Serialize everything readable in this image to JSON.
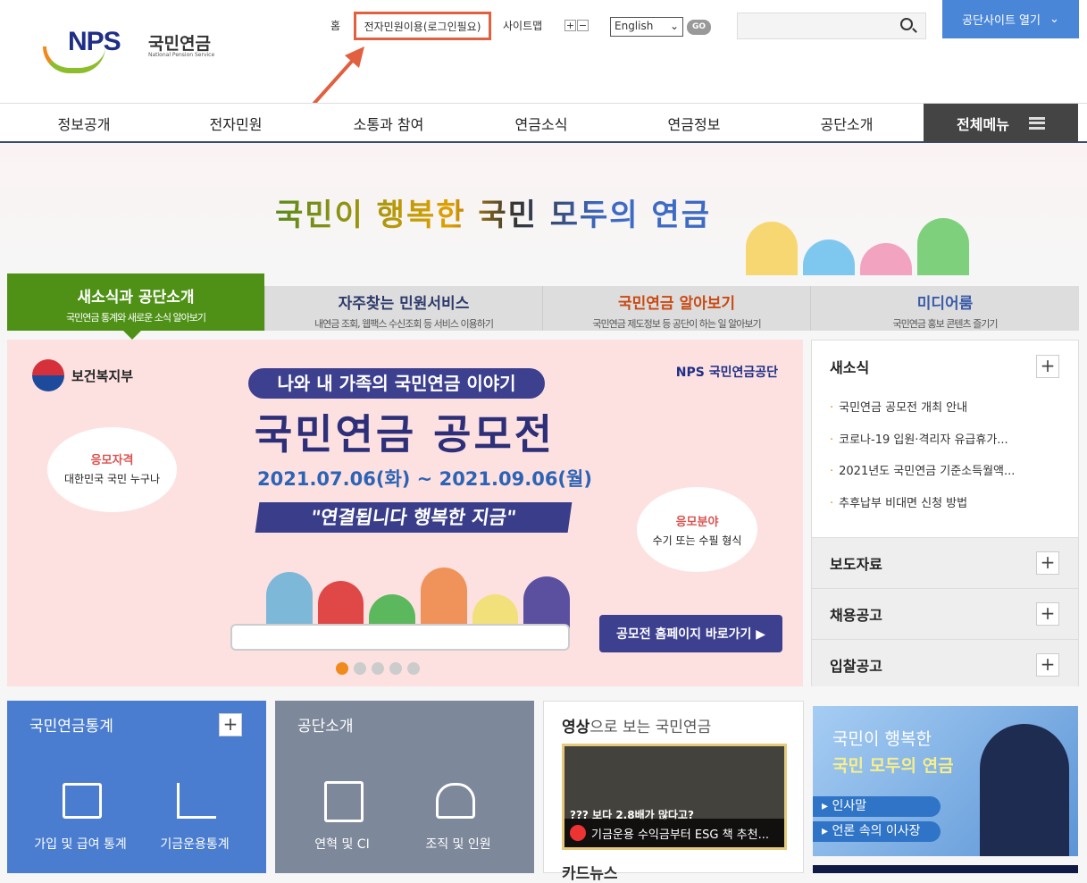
{
  "header": {
    "logo_text": "NPS",
    "logo_kor": "국민연금",
    "logo_eng": "National Pension Service",
    "util": {
      "home": "홈",
      "eservice": "전자민원이용(로그인필요)",
      "sitemap": "사이트맵",
      "zoom_in": "+",
      "zoom_out": "−",
      "language": "English",
      "go": "GO"
    },
    "search_placeholder": "",
    "site_open": "공단사이트 열기"
  },
  "gnb": {
    "items": [
      "정보공개",
      "전자민원",
      "소통과 참여",
      "연금소식",
      "연금정보",
      "공단소개"
    ],
    "all_menu": "전체메뉴"
  },
  "hero": {
    "slogan": "국민이 행복한 국민 모두의 연금"
  },
  "tabs": [
    {
      "title": "새소식과 공단소개",
      "sub": "국민연금 통계와 새로운 소식 알아보기",
      "color": "#ffffff"
    },
    {
      "title": "자주찾는 민원서비스",
      "sub": "내연금 조회, 웹팩스 수신조회 등 서비스 이용하기",
      "color": "#2d3a6b"
    },
    {
      "title": "국민연금 알아보기",
      "sub": "국민연금 제도정보 등 공단이 하는 일 알아보기",
      "color": "#c94a14"
    },
    {
      "title": "미디어룸",
      "sub": "국민연금 홍보 콘텐츠 즐기기",
      "color": "#3b5ba8"
    }
  ],
  "banner": {
    "ministry": "보건복지부",
    "agency": "NPS 국민연금공단",
    "pill": "나와 내 가족의 국민연금 이야기",
    "title": "국민연금 공모전",
    "date": "2021.07.06(화) ~ 2021.09.06(월)",
    "catch": "\"연결됩니다 행복한 지금\"",
    "left_bubble": {
      "title": "응모자격",
      "text": "대한민국 국민 누구나"
    },
    "right_bubble": {
      "title": "응모분야",
      "text": "수기 또는 수필 형식"
    },
    "button": "공모전 홈페이지 바로가기 ▶",
    "active_slide": 1,
    "slide_count": 5
  },
  "news": {
    "title": "새소식",
    "items": [
      "국민연금 공모전 개최 안내",
      "코로나-19 입원·격리자 유급휴가...",
      "2021년도 국민연금 기준소득월액...",
      "추후납부 비대면 신청 방법"
    ],
    "sections": [
      "보도자료",
      "채용공고",
      "입찰공고"
    ],
    "plus": "+"
  },
  "stats": {
    "title": "국민연금통계",
    "items": [
      "가입 및 급여 통계",
      "기금운용통계"
    ]
  },
  "about": {
    "title": "공단소개",
    "items": [
      "연혁 및 CI",
      "조직 및 인원"
    ]
  },
  "video": {
    "title_bold": "영상",
    "title_rest": "으로 보는 국민연금",
    "caption": "기금운용 수익금부터 ESG 책 추천...",
    "thumb_text": "??? 보다 2.8배가 많다고?",
    "next_title": "카드뉴스"
  },
  "ceo": {
    "quote1": "국민이 행복한",
    "quote2": "국민 모두의 연금",
    "links": [
      "인사말",
      "언론 속의 이사장"
    ]
  }
}
